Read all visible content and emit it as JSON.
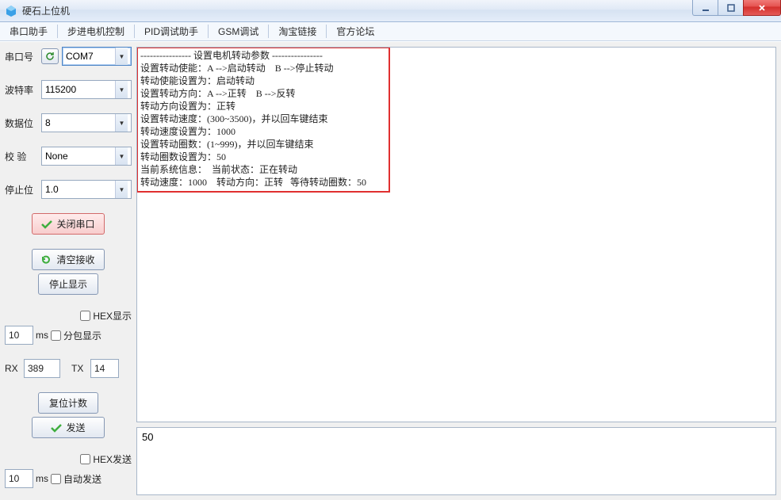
{
  "window": {
    "title": "硬石上位机"
  },
  "menu": {
    "items": [
      "串口助手",
      "步进电机控制",
      "PID调试助手",
      "GSM调试",
      "淘宝链接",
      "官方论坛"
    ]
  },
  "sidebar": {
    "port_label": "串口号",
    "port_value": "COM7",
    "baud_label": "波特率",
    "baud_value": "115200",
    "data_label": "数据位",
    "data_value": "8",
    "parity_label": "校   验",
    "parity_value": "None",
    "stop_label": "停止位",
    "stop_value": "1.0",
    "close_port": "关闭串口",
    "clear_recv": "清空接收",
    "stop_display": "停止显示",
    "hex_display": "HEX显示",
    "split_display": "分包显示",
    "ms_label": "ms",
    "interval_a": "10",
    "rx_label": "RX",
    "rx_value": "389",
    "tx_label": "TX",
    "tx_value": "14",
    "reset_count": "复位计数",
    "send": "发送",
    "hex_send": "HEX发送",
    "auto_send": "自动发送",
    "interval_b": "10"
  },
  "log": {
    "lines": [
      "---------------- 设置电机转动参数 ----------------",
      "设置转动使能：A -->启动转动    B -->停止转动",
      "转动使能设置为：启动转动",
      "设置转动方向：A -->正转    B -->反转",
      "转动方向设置为：正转",
      "设置转动速度：(300~3500)，并以回车键结束",
      "转动速度设置为：1000",
      "设置转动圈数：(1~999)，并以回车键结束",
      "转动圈数设置为：50",
      "当前系统信息：  当前状态：正在转动",
      "转动速度：1000    转动方向：正转   等待转动圈数：50"
    ]
  },
  "send_box": {
    "value": "50"
  }
}
